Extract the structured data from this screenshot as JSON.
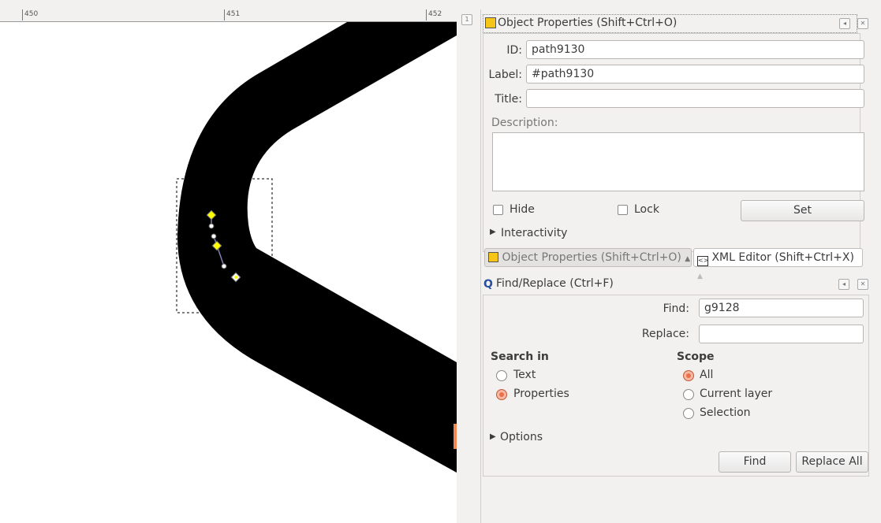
{
  "ruler": {
    "labels": [
      "450",
      "451",
      "452"
    ]
  },
  "object_properties": {
    "title": "Object Properties (Shift+Ctrl+O)",
    "id_label": "ID:",
    "id_value": "path9130",
    "label_label": "Label:",
    "label_value": "#path9130",
    "title_label": "Title:",
    "title_value": "",
    "description_label": "Description:",
    "description_value": "",
    "hide_label": "Hide",
    "lock_label": "Lock",
    "set_label": "Set",
    "interactivity_label": "Interactivity"
  },
  "dock_tabs": [
    {
      "label": "Object Properties (Shift+Ctrl+O)"
    },
    {
      "label": "XML Editor (Shift+Ctrl+X)"
    }
  ],
  "find_replace": {
    "title": "Find/Replace (Ctrl+F)",
    "find_label": "Find:",
    "find_value": "g9128",
    "replace_label": "Replace:",
    "replace_value": "",
    "search_in_label": "Search in",
    "search_in_options": [
      {
        "label": "Text",
        "selected": false
      },
      {
        "label": "Properties",
        "selected": true
      }
    ],
    "scope_label": "Scope",
    "scope_options": [
      {
        "label": "All",
        "selected": true
      },
      {
        "label": "Current layer",
        "selected": false
      },
      {
        "label": "Selection",
        "selected": false
      }
    ],
    "options_label": "Options",
    "find_button": "Find",
    "replace_all_button": "Replace All"
  },
  "colors": {
    "accent": "#e9704a",
    "node": "#ffff00"
  }
}
